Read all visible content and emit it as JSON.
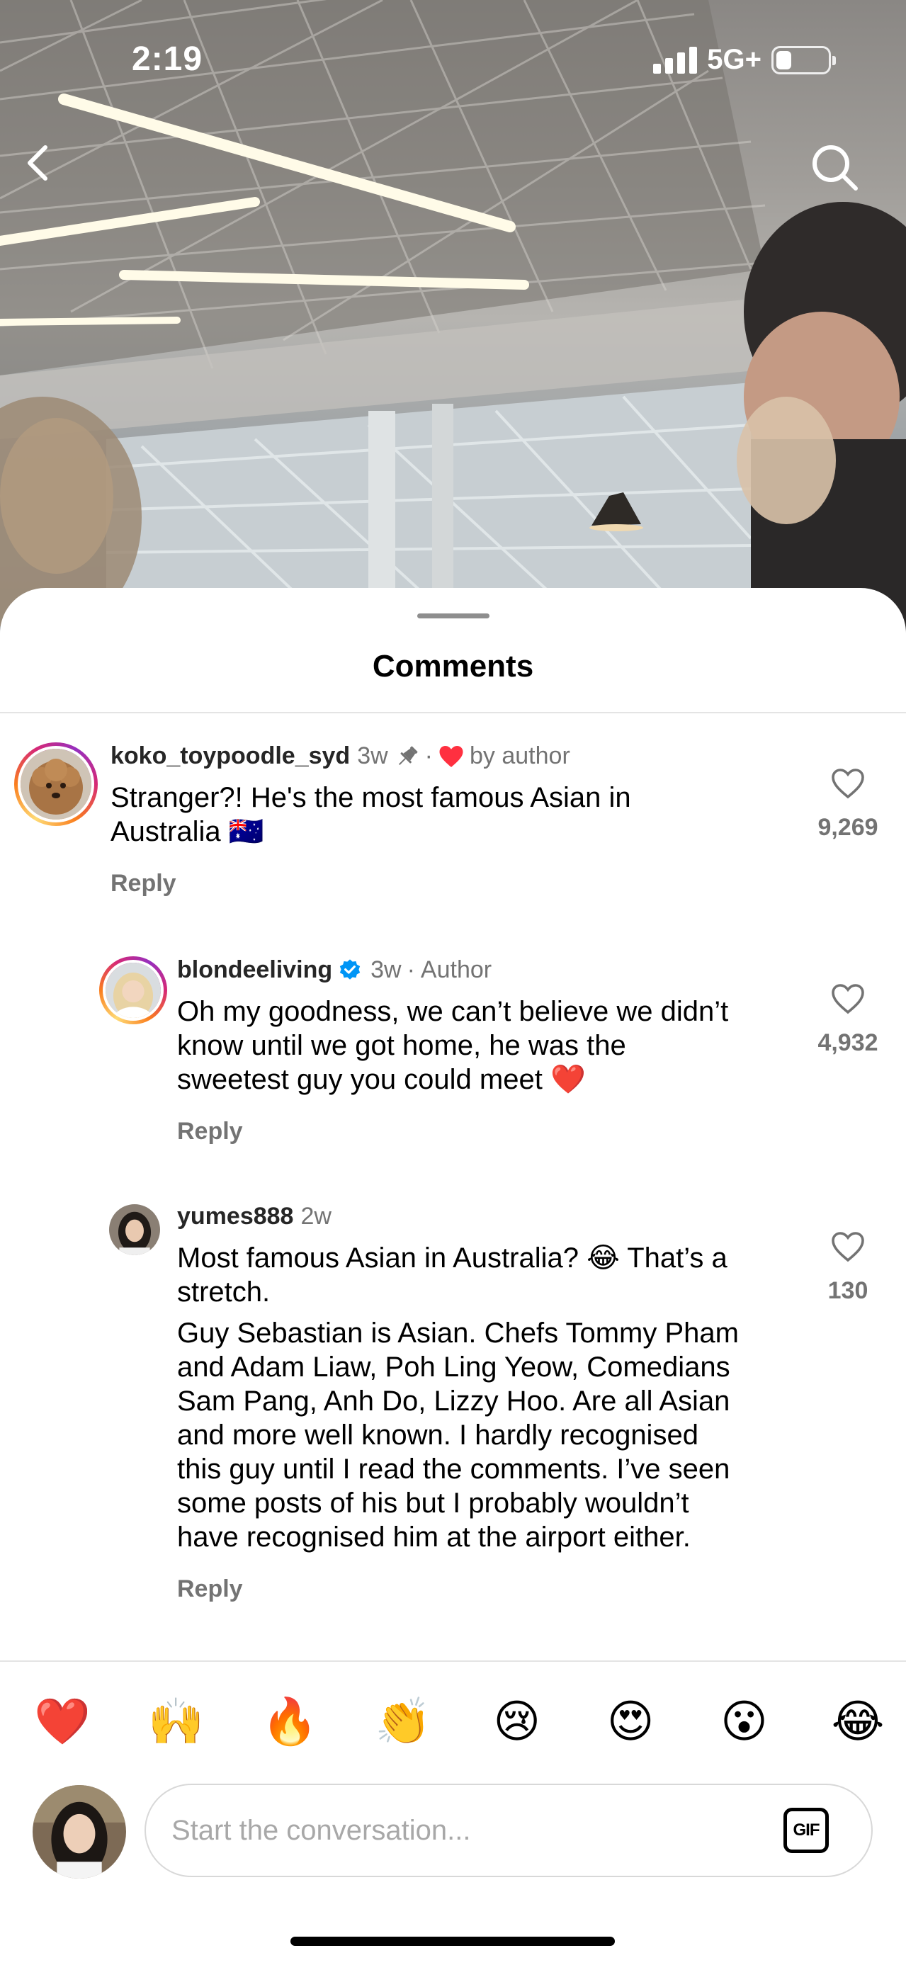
{
  "status_bar": {
    "time": "2:19",
    "network": "5G+"
  },
  "sheet": {
    "title": "Comments"
  },
  "comments": [
    {
      "username": "koko_toypoodle_syd",
      "time": "3w",
      "liked_by": "by author",
      "lines": [
        "Stranger?! He's the most famous Asian in",
        "Australia 🇦🇺"
      ],
      "reply_label": "Reply",
      "likes": "9,269"
    },
    {
      "username": "blondeeliving",
      "time": "3w",
      "sep": "·",
      "tag": "Author",
      "lines": [
        "Oh my goodness, we can’t believe we didn’t",
        "know until we got home, he was the",
        "sweetest guy you could meet ❤️"
      ],
      "reply_label": "Reply",
      "likes": "4,932"
    },
    {
      "username": "yumes888",
      "time": "2w",
      "lines": [
        "Most famous Asian in Australia? 😂 That’s a",
        "stretch."
      ],
      "lines2": [
        "Guy Sebastian is Asian. Chefs Tommy Pham",
        "and Adam Liaw, Poh Ling Yeow, Comedians",
        "Sam Pang, Anh Do, Lizzy Hoo. Are all Asian",
        "and more well known. I hardly recognised",
        "this guy until I read the comments. I’ve seen",
        "some posts of his but I probably wouldn’t",
        "have recognised him at the airport either."
      ],
      "reply_label": "Reply",
      "likes": "130"
    }
  ],
  "emoji_bar": [
    "❤️",
    "🙌",
    "🔥",
    "👏",
    "😢",
    "😍",
    "😮",
    "😂"
  ],
  "composer": {
    "placeholder": "Start the conversation...",
    "gif_label": "GIF"
  },
  "colors": {
    "heart_red": "#ff3040",
    "verified_blue": "#0095f6",
    "muted": "#737373"
  }
}
